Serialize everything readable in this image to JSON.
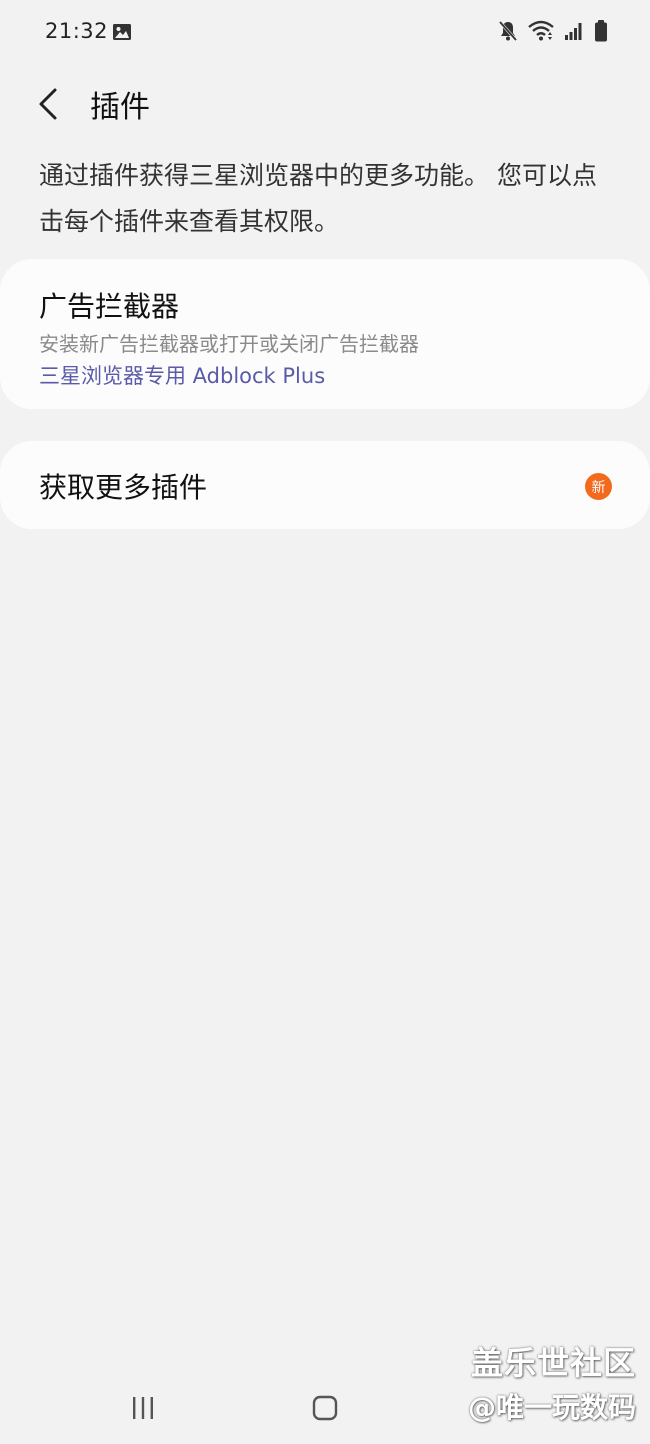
{
  "status_bar": {
    "time": "21:32",
    "icons": [
      "gallery-icon",
      "mute-icon",
      "wifi-icon",
      "signal-icon",
      "battery-icon"
    ]
  },
  "app_bar": {
    "title": "插件"
  },
  "description": "通过插件获得三星浏览器中的更多功能。 您可以点击每个插件来查看其权限。",
  "ad_blockers": {
    "title": "广告拦截器",
    "subtitle": "安装新广告拦截器或打开或关闭广告拦截器",
    "link": "三星浏览器专用 Adblock Plus"
  },
  "get_more": {
    "title": "获取更多插件",
    "badge": "新"
  },
  "watermark": {
    "line1": "盖乐世社区",
    "line2": "@唯一玩数码"
  },
  "colors": {
    "background": "#f2f2f2",
    "card": "#fcfcfc",
    "link": "#5a5aa8",
    "badge": "#f26b1d"
  }
}
